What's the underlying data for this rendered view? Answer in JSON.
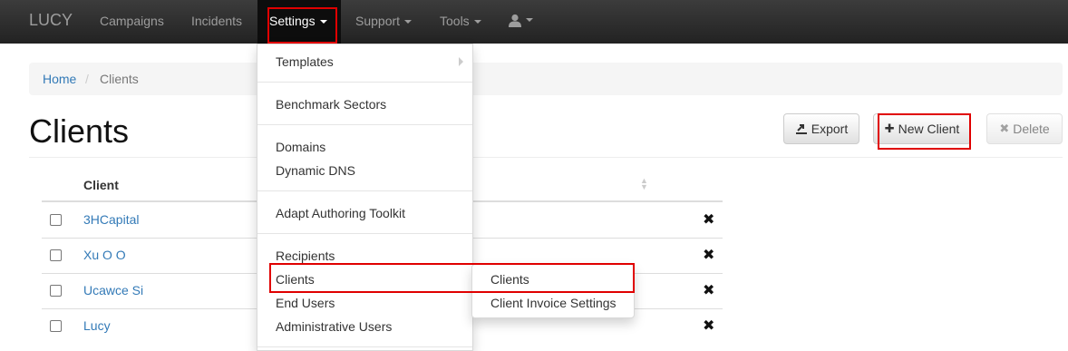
{
  "navbar": {
    "brand": "LUCY",
    "items": [
      {
        "label": "Campaigns"
      },
      {
        "label": "Incidents"
      },
      {
        "label": "Settings"
      },
      {
        "label": "Support"
      },
      {
        "label": "Tools"
      }
    ],
    "user_icon": "user-icon"
  },
  "breadcrumb": {
    "home": "Home",
    "separator": "/",
    "current": "Clients"
  },
  "page": {
    "title": "Clients"
  },
  "toolbar": {
    "export_label": "Export",
    "export_icon": "export-icon",
    "new_client_label": "New Client",
    "new_client_icon": "plus-icon",
    "delete_label": "Delete",
    "delete_icon": "remove-icon"
  },
  "table": {
    "header": {
      "client": "Client"
    },
    "rows": [
      {
        "client": "3HCapital"
      },
      {
        "client": "Xu O O"
      },
      {
        "client": "Ucawce Si"
      },
      {
        "client": "Lucy"
      }
    ]
  },
  "settings_menu": {
    "items": [
      {
        "label": "Templates"
      },
      {
        "label": "Benchmark Sectors"
      },
      {
        "label": "Domains"
      },
      {
        "label": "Dynamic DNS"
      },
      {
        "label": "Adapt Authoring Toolkit"
      },
      {
        "label": "Recipients"
      },
      {
        "label": "Clients"
      },
      {
        "label": "End Users"
      },
      {
        "label": "Administrative Users"
      }
    ]
  },
  "clients_submenu": {
    "items": [
      {
        "label": "Clients"
      },
      {
        "label": "Client Invoice Settings"
      }
    ]
  },
  "colors": {
    "navbar": "#222222",
    "link": "#337ab7",
    "highlight": "#e00000"
  }
}
